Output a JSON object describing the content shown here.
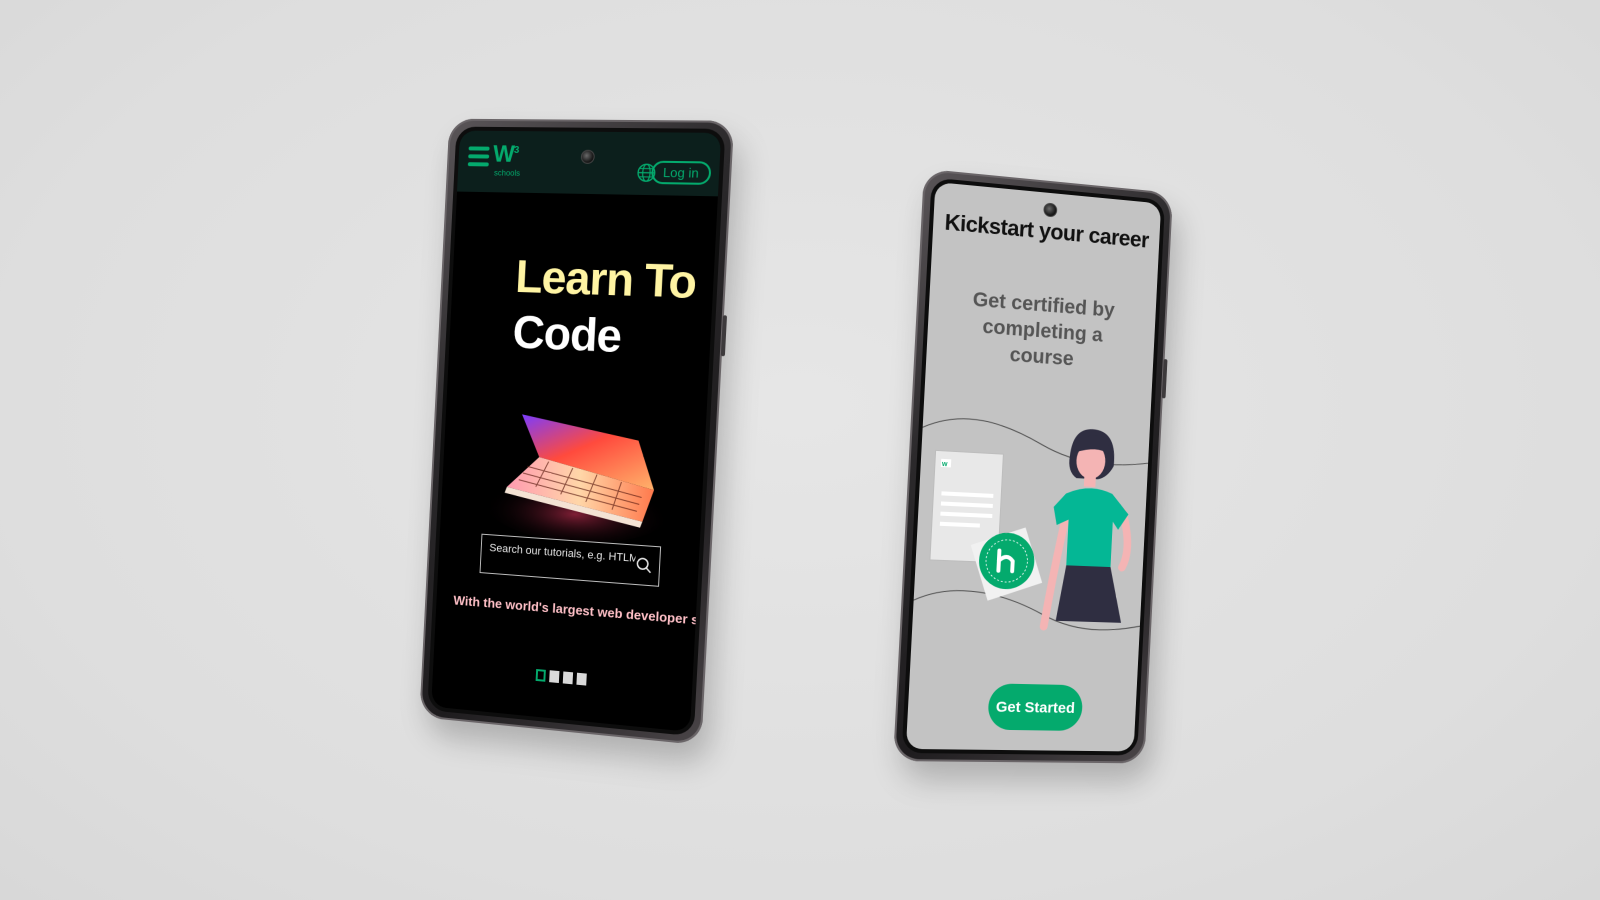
{
  "left_phone": {
    "header": {
      "logo_text": "W",
      "logo_sup": "3",
      "logo_sub": "schools",
      "login_label": "Log in",
      "globe_icon": "globe-icon",
      "menu_icon": "hamburger-menu-icon"
    },
    "hero": {
      "line_1": "Learn To",
      "line_2": "Code"
    },
    "search": {
      "placeholder": "Search our tutorials, e.g. HTLM",
      "icon": "search-icon"
    },
    "tagline": "With the world's largest web developer site.",
    "pager": {
      "pages": 4,
      "active_index": 0
    }
  },
  "right_phone": {
    "title": "Kickstart your career",
    "subtitle": "Get certified by completing a course",
    "cta_label": "Get Started"
  },
  "colors": {
    "brand_green": "#04aa6d",
    "hero_yellow": "#fff4a3",
    "tagline_pink": "#ffc0c7",
    "header_dark": "#0c1f1c",
    "right_screen_gray": "#c3c3c3",
    "background": "#e0e0e0"
  }
}
